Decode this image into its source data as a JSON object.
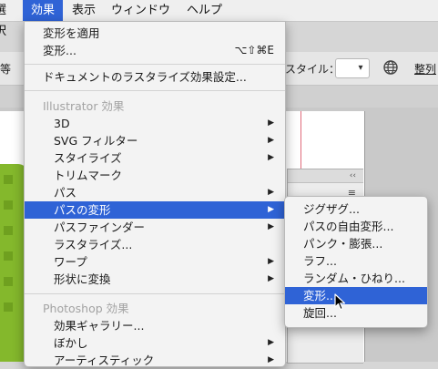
{
  "menubar": {
    "items": [
      "選択",
      "効果",
      "表示",
      "ウィンドウ",
      "ヘルプ"
    ],
    "active_index": 1
  },
  "toolbar": {
    "left_text": "等",
    "style_label": "スタイル：",
    "align_label": "整列"
  },
  "effect_menu": {
    "apply_last": "変形を適用",
    "last_effect": "変形...",
    "last_effect_shortcut": "⌥⇧⌘E",
    "rasterize_settings": "ドキュメントのラスタライズ効果設定...",
    "illustrator_heading": "Illustrator 効果",
    "items": [
      {
        "label": "3D",
        "submenu": true
      },
      {
        "label": "SVG フィルター",
        "submenu": true
      },
      {
        "label": "スタイライズ",
        "submenu": true
      },
      {
        "label": "トリムマーク",
        "submenu": false
      },
      {
        "label": "パス",
        "submenu": true
      },
      {
        "label": "パスの変形",
        "submenu": true,
        "highlighted": true
      },
      {
        "label": "パスファインダー",
        "submenu": true
      },
      {
        "label": "ラスタライズ...",
        "submenu": false
      },
      {
        "label": "ワープ",
        "submenu": true
      },
      {
        "label": "形状に変換",
        "submenu": true
      }
    ],
    "photoshop_heading": "Photoshop 効果",
    "ps_items": [
      {
        "label": "効果ギャラリー...",
        "submenu": false
      },
      {
        "label": "ぼかし",
        "submenu": true
      },
      {
        "label": "アーティスティック",
        "submenu": true
      }
    ]
  },
  "submenu": {
    "items": [
      {
        "label": "ジグザグ..."
      },
      {
        "label": "パスの自由変形..."
      },
      {
        "label": "パンク・膨張..."
      },
      {
        "label": "ラフ..."
      },
      {
        "label": "ランダム・ひねり..."
      },
      {
        "label": "変形...",
        "highlighted": true
      },
      {
        "label": "旋回..."
      }
    ]
  },
  "icons": [
    "chevron-right-icon",
    "globe-icon",
    "panel-menu-icon",
    "collapse-icon",
    "pointer-cursor-icon",
    "chevron-down-icon"
  ],
  "colors": {
    "highlight": "#2f63d6",
    "menu_bg": "#f3f3f3",
    "disabled_text": "#a3a3a3",
    "artwork_green": "#84b82c"
  }
}
